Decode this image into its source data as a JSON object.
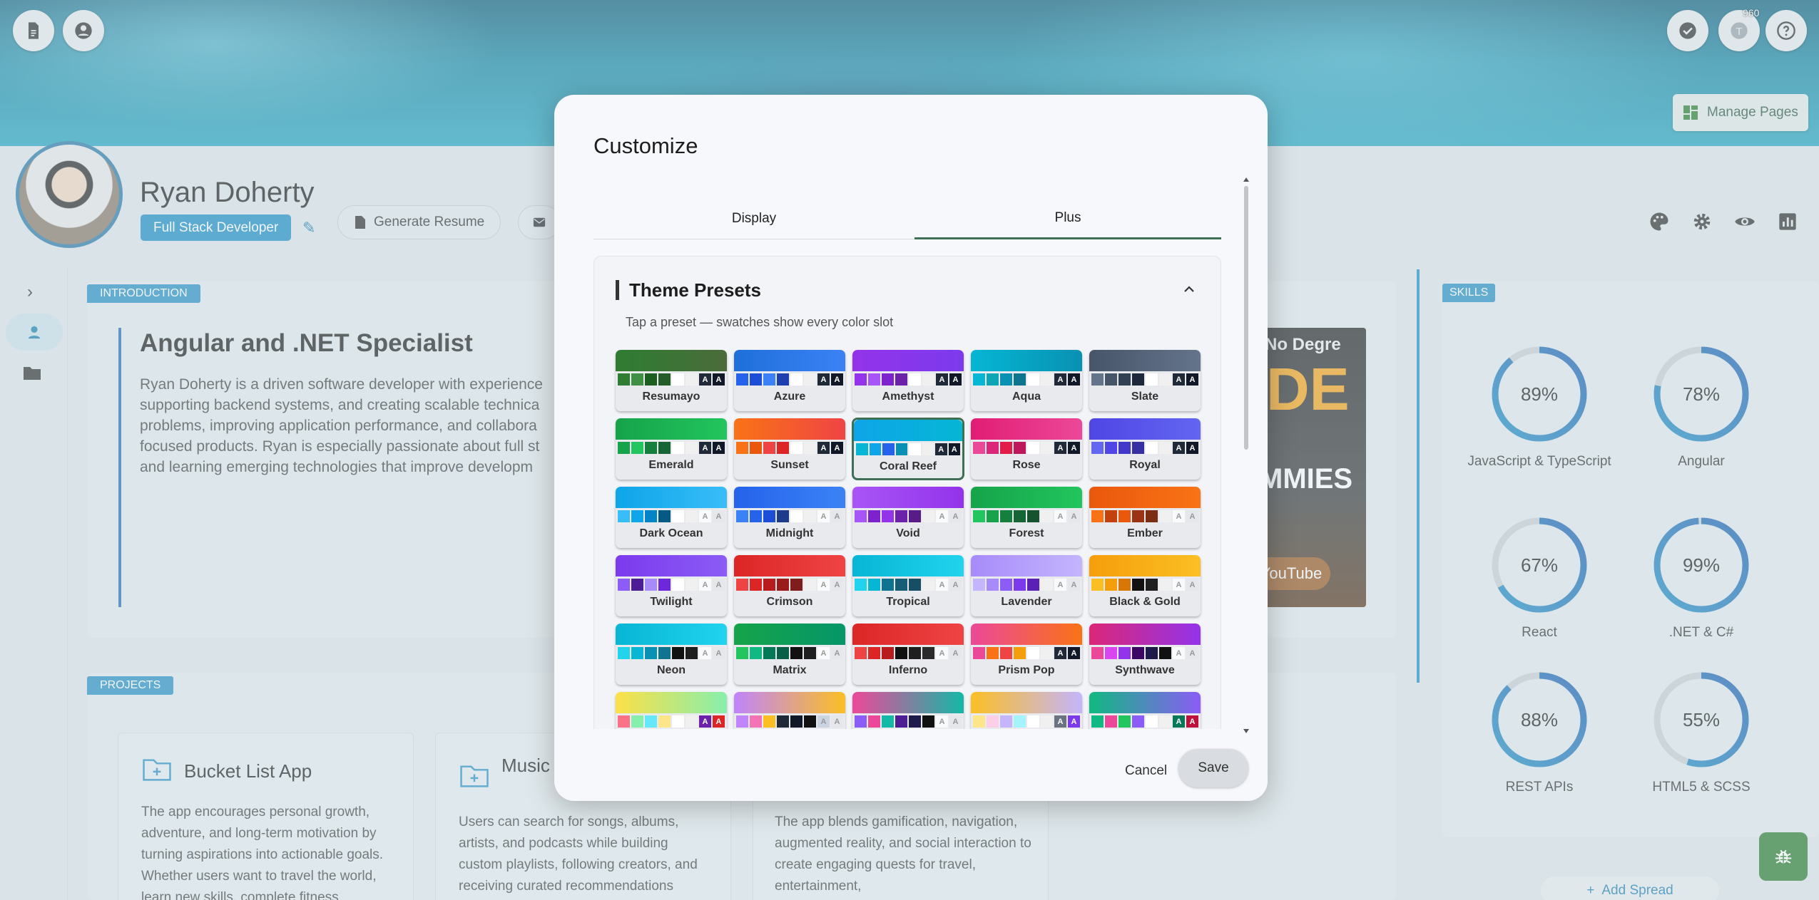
{
  "profile": {
    "name": "Ryan Doherty",
    "role": "Full Stack Developer",
    "generate_resume": "Generate Resume"
  },
  "topbar": {
    "tokens_badge": "960",
    "manage_pages": "Manage Pages"
  },
  "intro": {
    "tag": "INTRODUCTION",
    "title": "Angular and .NET Specialist",
    "text": "Ryan Doherty is a driven software developer with experience supporting backend systems, and creating scalable technica problems, improving application performance, and collabora focused products. Ryan is especially passionate about full st and learning emerging technologies that improve developm",
    "video_text_1": "No Degre",
    "video_text_2": "DE",
    "video_text_3": "MMIES",
    "video_text_4": "YouTube"
  },
  "projects": {
    "tag": "PROJECTS",
    "cards": [
      {
        "title": "Bucket List App",
        "text": "The app encourages personal growth, adventure, and long-term motivation by turning aspirations into actionable goals. Whether users want to travel the world, learn new skills, complete fitness"
      },
      {
        "title": "Music Discov",
        "text": "Users can search for songs, albums, artists, and podcasts while building custom playlists, following creators, and receiving curated recommendations"
      },
      {
        "title": "",
        "text": "The app blends gamification, navigation, augmented reality, and social interaction to create engaging quests for travel, entertainment,"
      }
    ]
  },
  "skills": {
    "tag": "SKILLS",
    "items": [
      {
        "pct": "89%",
        "value": 89,
        "label": "JavaScript & TypeScript"
      },
      {
        "pct": "78%",
        "value": 78,
        "label": "Angular"
      },
      {
        "pct": "67%",
        "value": 67,
        "label": "React"
      },
      {
        "pct": "99%",
        "value": 99,
        "label": ".NET & C#"
      },
      {
        "pct": "88%",
        "value": 88,
        "label": "REST APIs"
      },
      {
        "pct": "55%",
        "value": 55,
        "label": "HTML5 & SCSS"
      }
    ],
    "add_spread": "Add Spread"
  },
  "modal": {
    "title": "Customize",
    "tabs": {
      "display": "Display",
      "plus": "Plus"
    },
    "presets_heading": "Theme Presets",
    "presets_sub": "Tap a preset — swatches show every color slot",
    "cancel": "Cancel",
    "save": "Save",
    "selected_preset": "Coral Reef",
    "presets": [
      {
        "name": "Resumayo",
        "grad": [
          "#2e7d32",
          "#4a6b3a"
        ],
        "sw": [
          "#2e7d32",
          "#3f8f45",
          "#1b5e20",
          "#255d2a",
          "#ffffff",
          "#f0f0f0",
          "#1f2937",
          "#111827"
        ]
      },
      {
        "name": "Azure",
        "grad": [
          "#1e6fd9",
          "#3b82f6"
        ],
        "sw": [
          "#2563eb",
          "#1d4ed8",
          "#3b82f6",
          "#1e40af",
          "#ffffff",
          "#f0f0f0",
          "#1f2937",
          "#111827"
        ]
      },
      {
        "name": "Amethyst",
        "grad": [
          "#9333ea",
          "#7c3aed"
        ],
        "sw": [
          "#9333ea",
          "#a855f7",
          "#7e22ce",
          "#6b21a8",
          "#ffffff",
          "#f0f0f0",
          "#1f2937",
          "#111827"
        ]
      },
      {
        "name": "Aqua",
        "grad": [
          "#06b6d4",
          "#0891b2"
        ],
        "sw": [
          "#06b6d4",
          "#0ea5b7",
          "#0891b2",
          "#0e7490",
          "#ffffff",
          "#f0f0f0",
          "#1f2937",
          "#111827"
        ]
      },
      {
        "name": "Slate",
        "grad": [
          "#475569",
          "#64748b"
        ],
        "sw": [
          "#64748b",
          "#475569",
          "#334155",
          "#1e293b",
          "#ffffff",
          "#f0f0f0",
          "#1f2937",
          "#111827"
        ]
      },
      {
        "name": "Emerald",
        "grad": [
          "#16a34a",
          "#22c55e"
        ],
        "sw": [
          "#16a34a",
          "#22c55e",
          "#15803d",
          "#166534",
          "#ffffff",
          "#f0f0f0",
          "#1f2937",
          "#111827"
        ]
      },
      {
        "name": "Sunset",
        "grad": [
          "#f97316",
          "#ef4444"
        ],
        "sw": [
          "#f97316",
          "#ea580c",
          "#ef4444",
          "#dc2626",
          "#ffffff",
          "#f0f0f0",
          "#1f2937",
          "#111827"
        ]
      },
      {
        "name": "Coral Reef",
        "grad": [
          "#0ea5e9",
          "#06b6d4"
        ],
        "sw": [
          "#06b6d4",
          "#0ea5e9",
          "#2563eb",
          "#0891b2",
          "#ffffff",
          "#f0f0f0",
          "#1f2937",
          "#111827"
        ]
      },
      {
        "name": "Rose",
        "grad": [
          "#e11d74",
          "#ec4899"
        ],
        "sw": [
          "#ec4899",
          "#db2777",
          "#e11d48",
          "#be185d",
          "#ffffff",
          "#f0f0f0",
          "#1f2937",
          "#111827"
        ]
      },
      {
        "name": "Royal",
        "grad": [
          "#4f46e5",
          "#6366f1"
        ],
        "sw": [
          "#6366f1",
          "#4f46e5",
          "#4338ca",
          "#3730a3",
          "#ffffff",
          "#f0f0f0",
          "#1f2937",
          "#111827"
        ]
      },
      {
        "name": "Dark Ocean",
        "grad": [
          "#0ea5e9",
          "#38bdf8"
        ],
        "sw": [
          "#38bdf8",
          "#0ea5e9",
          "#0284c7",
          "#075985",
          "#ffffff",
          "#f0f0f0",
          "#f8fafc",
          "#e5e7eb"
        ]
      },
      {
        "name": "Midnight",
        "grad": [
          "#2563eb",
          "#3b82f6"
        ],
        "sw": [
          "#3b82f6",
          "#2563eb",
          "#1d4ed8",
          "#1e3a8a",
          "#ffffff",
          "#f0f0f0",
          "#f8fafc",
          "#e5e7eb"
        ]
      },
      {
        "name": "Void",
        "grad": [
          "#a855f7",
          "#9333ea"
        ],
        "sw": [
          "#a855f7",
          "#7e22ce",
          "#9333ea",
          "#6b21a8",
          "#581c87",
          "#f0f0f0",
          "#f8fafc",
          "#e5e7eb"
        ]
      },
      {
        "name": "Forest",
        "grad": [
          "#16a34a",
          "#22c55e"
        ],
        "sw": [
          "#22c55e",
          "#16a34a",
          "#15803d",
          "#166534",
          "#14532d",
          "#f0f0f0",
          "#f8fafc",
          "#e5e7eb"
        ]
      },
      {
        "name": "Ember",
        "grad": [
          "#ea580c",
          "#f97316"
        ],
        "sw": [
          "#f97316",
          "#c2410c",
          "#ea580c",
          "#9a3412",
          "#7c2d12",
          "#f0f0f0",
          "#f8fafc",
          "#e5e7eb"
        ]
      },
      {
        "name": "Twilight",
        "grad": [
          "#7c3aed",
          "#8b5cf6"
        ],
        "sw": [
          "#8b5cf6",
          "#4c1d95",
          "#a78bfa",
          "#6d28d9",
          "#ffffff",
          "#f0f0f0",
          "#f8fafc",
          "#e5e7eb"
        ]
      },
      {
        "name": "Crimson",
        "grad": [
          "#dc2626",
          "#ef4444"
        ],
        "sw": [
          "#ef4444",
          "#dc2626",
          "#b91c1c",
          "#991b1b",
          "#7f1d1d",
          "#f0f0f0",
          "#f8fafc",
          "#e5e7eb"
        ]
      },
      {
        "name": "Tropical",
        "grad": [
          "#06b6d4",
          "#22d3ee"
        ],
        "sw": [
          "#22d3ee",
          "#06b6d4",
          "#0e7490",
          "#155e75",
          "#164e63",
          "#f0f0f0",
          "#f8fafc",
          "#e5e7eb"
        ]
      },
      {
        "name": "Lavender",
        "grad": [
          "#a78bfa",
          "#c4b5fd"
        ],
        "sw": [
          "#c4b5fd",
          "#a78bfa",
          "#8b5cf6",
          "#7c3aed",
          "#5b21b6",
          "#f0f0f0",
          "#f8fafc",
          "#e5e7eb"
        ]
      },
      {
        "name": "Black & Gold",
        "grad": [
          "#f59e0b",
          "#fbbf24"
        ],
        "sw": [
          "#fbbf24",
          "#f59e0b",
          "#d97706",
          "#111111",
          "#1f1f1f",
          "#f0f0f0",
          "#f8fafc",
          "#e5e7eb"
        ]
      },
      {
        "name": "Neon",
        "grad": [
          "#06b6d4",
          "#22d3ee"
        ],
        "sw": [
          "#22d3ee",
          "#06b6d4",
          "#0891b2",
          "#0e7490",
          "#111111",
          "#1f1f1f",
          "#f8fafc",
          "#e5e7eb"
        ]
      },
      {
        "name": "Matrix",
        "grad": [
          "#16a34a",
          "#059669"
        ],
        "sw": [
          "#22c55e",
          "#10b981",
          "#047857",
          "#065f46",
          "#111111",
          "#1f1f1f",
          "#f8fafc",
          "#e5e7eb"
        ]
      },
      {
        "name": "Inferno",
        "grad": [
          "#dc2626",
          "#ef4444"
        ],
        "sw": [
          "#ef4444",
          "#dc2626",
          "#b91c1c",
          "#111111",
          "#1f1f1f",
          "#2b2b2b",
          "#f8fafc",
          "#e5e7eb"
        ]
      },
      {
        "name": "Prism Pop",
        "grad": [
          "#ec4899",
          "#f97316"
        ],
        "sw": [
          "#ec4899",
          "#f97316",
          "#ef4444",
          "#f59e0b",
          "#ffffff",
          "#f0f0f0",
          "#1f2937",
          "#111827"
        ]
      },
      {
        "name": "Synthwave",
        "grad": [
          "#db2777",
          "#9333ea"
        ],
        "sw": [
          "#ec4899",
          "#d946ef",
          "#9333ea",
          "#3b0764",
          "#1e1b4b",
          "#111111",
          "#f8fafc",
          "#e5e7eb"
        ]
      },
      {
        "name": "",
        "grad": [
          "#fde047",
          "#86efac"
        ],
        "sw": [
          "#fb7185",
          "#86efac",
          "#67e8f9",
          "#fde68a",
          "#ffffff",
          "#f0f0f0",
          "#6b21a8",
          "#dc2626"
        ]
      },
      {
        "name": "",
        "grad": [
          "#c084fc",
          "#fbbf24"
        ],
        "sw": [
          "#c084fc",
          "#f472b6",
          "#fbbf24",
          "#1f2937",
          "#111827",
          "#111111",
          "#cbd5e1",
          "#e5e7eb"
        ]
      },
      {
        "name": "",
        "grad": [
          "#ec4899",
          "#14b8a6"
        ],
        "sw": [
          "#8b5cf6",
          "#ec4899",
          "#14b8a6",
          "#4c1d95",
          "#1e1b4b",
          "#111111",
          "#f8fafc",
          "#e5e7eb"
        ]
      },
      {
        "name": "",
        "grad": [
          "#fbbf24",
          "#c4b5fd"
        ],
        "sw": [
          "#fde68a",
          "#fbcfe8",
          "#c4b5fd",
          "#a5f3fc",
          "#ffffff",
          "#f0f0f0",
          "#6b7280",
          "#7c3aed"
        ]
      },
      {
        "name": "",
        "grad": [
          "#10b981",
          "#8b5cf6"
        ],
        "sw": [
          "#10b981",
          "#ec4899",
          "#22c55e",
          "#8b5cf6",
          "#ffffff",
          "#f0f0f0",
          "#047857",
          "#be123c"
        ]
      }
    ]
  }
}
